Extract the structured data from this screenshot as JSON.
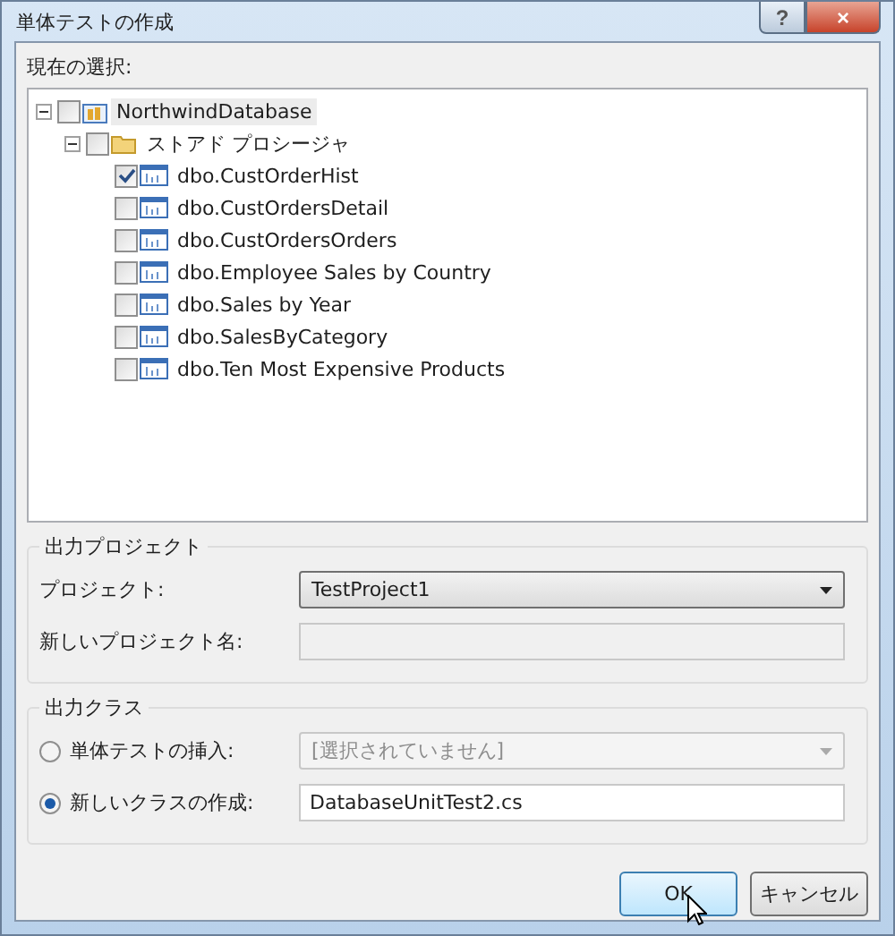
{
  "window": {
    "title": "単体テストの作成",
    "buttons": [
      "?",
      "×"
    ]
  },
  "selection": {
    "label": "現在の選択:",
    "tree": [
      {
        "label": "NorthwindDatabase",
        "kind": "database",
        "expanded": true,
        "checked": false,
        "selected": true,
        "children": [
          {
            "label": "ストアド プロシージャ",
            "kind": "folder",
            "expanded": true,
            "checked": false,
            "selected": false,
            "children": [
              {
                "label": "dbo.CustOrderHist",
                "kind": "procedure",
                "checked": true,
                "selected": false
              },
              {
                "label": "dbo.CustOrdersDetail",
                "kind": "procedure",
                "checked": false,
                "selected": false
              },
              {
                "label": "dbo.CustOrdersOrders",
                "kind": "procedure",
                "checked": false,
                "selected": false
              },
              {
                "label": "dbo.Employee Sales by Country",
                "kind": "procedure",
                "checked": false,
                "selected": false
              },
              {
                "label": "dbo.Sales by Year",
                "kind": "procedure",
                "checked": false,
                "selected": false
              },
              {
                "label": "dbo.SalesByCategory",
                "kind": "procedure",
                "checked": false,
                "selected": false
              },
              {
                "label": "dbo.Ten Most Expensive Products",
                "kind": "procedure",
                "checked": false,
                "selected": false
              }
            ]
          }
        ]
      }
    ]
  },
  "output_project": {
    "title": "出力プロジェクト",
    "rows": [
      {
        "kind": "dropdown",
        "label": "プロジェクト:",
        "value": "TestProject1",
        "disabled": false
      },
      {
        "kind": "text",
        "label": "新しいプロジェクト名:",
        "disabled": true
      }
    ]
  },
  "output_class": {
    "title": "出力クラス",
    "rows": [
      {
        "kind": "dropdown",
        "label": "単体テストの挿入:",
        "value": "[選択されていません]",
        "disabled": true,
        "selected": false
      },
      {
        "kind": "text",
        "label": "新しいクラスの作成:",
        "value": "DatabaseUnitTest2.cs",
        "disabled": false,
        "selected": true
      }
    ]
  },
  "buttons": [
    {
      "label": "OK",
      "kind": "primary"
    },
    {
      "label": "キャンセル",
      "kind": "normal"
    }
  ]
}
